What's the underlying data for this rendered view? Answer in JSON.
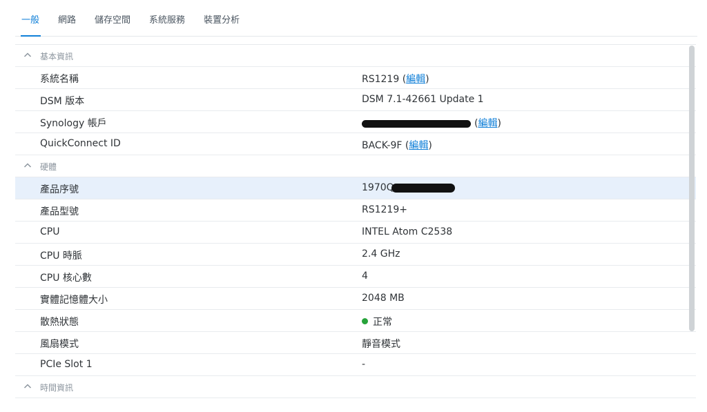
{
  "tabs": [
    {
      "label": "一般",
      "active": true
    },
    {
      "label": "網路",
      "active": false
    },
    {
      "label": "儲存空間",
      "active": false
    },
    {
      "label": "系統服務",
      "active": false
    },
    {
      "label": "裝置分析",
      "active": false
    }
  ],
  "sections": {
    "basic": {
      "title": "基本資訊"
    },
    "hardware": {
      "title": "硬體"
    },
    "time": {
      "title": "時間資訊"
    }
  },
  "basic": {
    "system_name": {
      "label": "系統名稱",
      "value": "RS1219",
      "edit": "編輯"
    },
    "dsm_version": {
      "label": "DSM 版本",
      "value": "DSM 7.1-42661 Update 1"
    },
    "synology_account": {
      "label": "Synology 帳戶",
      "edit": "編輯"
    },
    "quickconnect": {
      "label": "QuickConnect ID",
      "value": "BACK-9F",
      "edit": "編輯"
    }
  },
  "hardware": {
    "serial": {
      "label": "產品序號",
      "value_prefix": "1970Q"
    },
    "model": {
      "label": "產品型號",
      "value": "RS1219+"
    },
    "cpu": {
      "label": "CPU",
      "value": "INTEL Atom C2538"
    },
    "cpu_clock": {
      "label": "CPU 時脈",
      "value": "2.4 GHz"
    },
    "cpu_cores": {
      "label": "CPU 核心數",
      "value": "4"
    },
    "memory": {
      "label": "實體記憶體大小",
      "value": "2048 MB"
    },
    "thermal": {
      "label": "散熱狀態",
      "value": "正常",
      "status_color": "#27a33a"
    },
    "fan_mode": {
      "label": "風扇模式",
      "value": "靜音模式"
    },
    "pcie_slot1": {
      "label": "PCIe Slot 1",
      "value": "-"
    }
  },
  "colors": {
    "accent": "#0f7fd8",
    "selected_row": "#e7f0fb",
    "ok": "#27a33a"
  }
}
